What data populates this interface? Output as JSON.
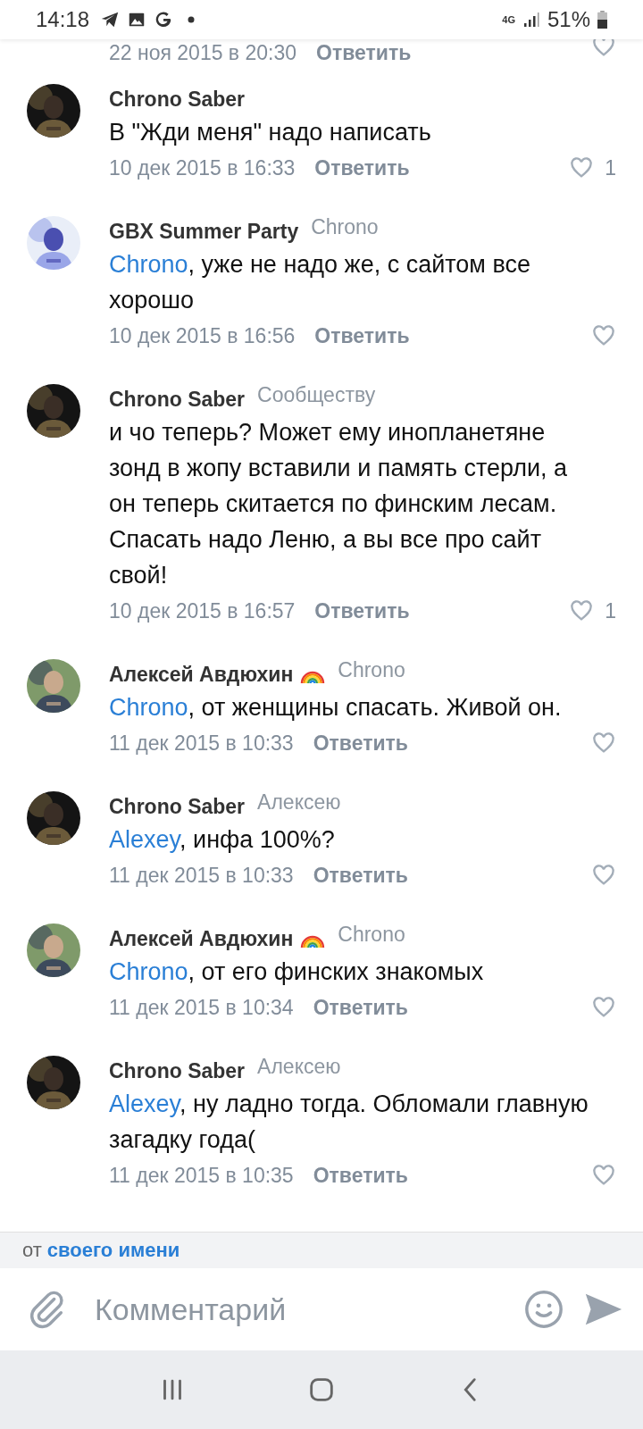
{
  "status_bar": {
    "time": "14:18",
    "network": "4G",
    "battery": "51%"
  },
  "previous_comment": {
    "date": "22 ноя 2015 в 20:30",
    "reply_label": "Ответить"
  },
  "comments": [
    {
      "author": "Chrono Saber",
      "emoji_badge": false,
      "text": "В \"Жди меня\" надо написать",
      "date": "10 дек 2015 в 16:33",
      "reply_label": "Ответить",
      "likes": "1"
    },
    {
      "author": "GBX Summer Party",
      "emoji_badge": false,
      "reply_to": "Chrono",
      "mention": "Chrono",
      "text": ", уже не надо же, с сайтом все хорошо",
      "date": "10 дек 2015 в 16:56",
      "reply_label": "Ответить"
    },
    {
      "author": "Chrono Saber",
      "emoji_badge": false,
      "reply_to": "Сообществу",
      "text": "и чо теперь? Может ему инопланетяне зонд в жопу вставили и память стерли, а он теперь скитается по финским лесам. Спасать надо Леню, а вы все про сайт свой!",
      "date": "10 дек 2015 в 16:57",
      "reply_label": "Ответить",
      "likes": "1"
    },
    {
      "author": "Алексей Авдюхин",
      "emoji_badge": true,
      "reply_to": "Chrono",
      "mention": "Chrono",
      "text": ", от женщины спасать. Живой он.",
      "date": "11 дек 2015 в 10:33",
      "reply_label": "Ответить"
    },
    {
      "author": "Chrono Saber",
      "emoji_badge": false,
      "reply_to": "Алексею",
      "mention": "Alexey",
      "text": ", инфа 100%?",
      "date": "11 дек 2015 в 10:33",
      "reply_label": "Ответить"
    },
    {
      "author": "Алексей Авдюхин",
      "emoji_badge": true,
      "reply_to": "Chrono",
      "mention": "Chrono",
      "text": ", от его финских знакомых",
      "date": "11 дек 2015 в 10:34",
      "reply_label": "Ответить"
    },
    {
      "author": "Chrono Saber",
      "emoji_badge": false,
      "reply_to": "Алексею",
      "mention": "Alexey",
      "text": ", ну ладно тогда. Обломали главную загадку года(",
      "date": "11 дек 2015 в 10:35",
      "reply_label": "Ответить"
    }
  ],
  "identity": {
    "prefix": "от",
    "link": "своего имени"
  },
  "composer": {
    "placeholder": "Комментарий"
  }
}
